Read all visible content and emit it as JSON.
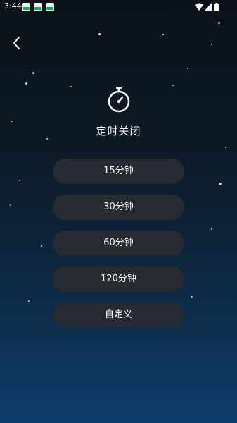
{
  "status_bar": {
    "time": "3:44",
    "notification_icons": [
      "app-notification-icon",
      "app-notification-icon",
      "app-notification-icon"
    ],
    "system_icons": [
      "wifi-icon",
      "signal-icon",
      "battery-icon"
    ]
  },
  "header": {
    "back_icon": "chevron-left-icon"
  },
  "timer": {
    "icon": "stopwatch-icon",
    "title": "定时关闭"
  },
  "options": [
    {
      "label": "15分钟"
    },
    {
      "label": "30分钟"
    },
    {
      "label": "60分钟"
    },
    {
      "label": "120分钟"
    },
    {
      "label": "自定义"
    }
  ],
  "colors": {
    "background_top": "#0b1118",
    "background_bottom": "#0e3e6e",
    "button_bg": "#262b32",
    "text": "#ffffff"
  }
}
